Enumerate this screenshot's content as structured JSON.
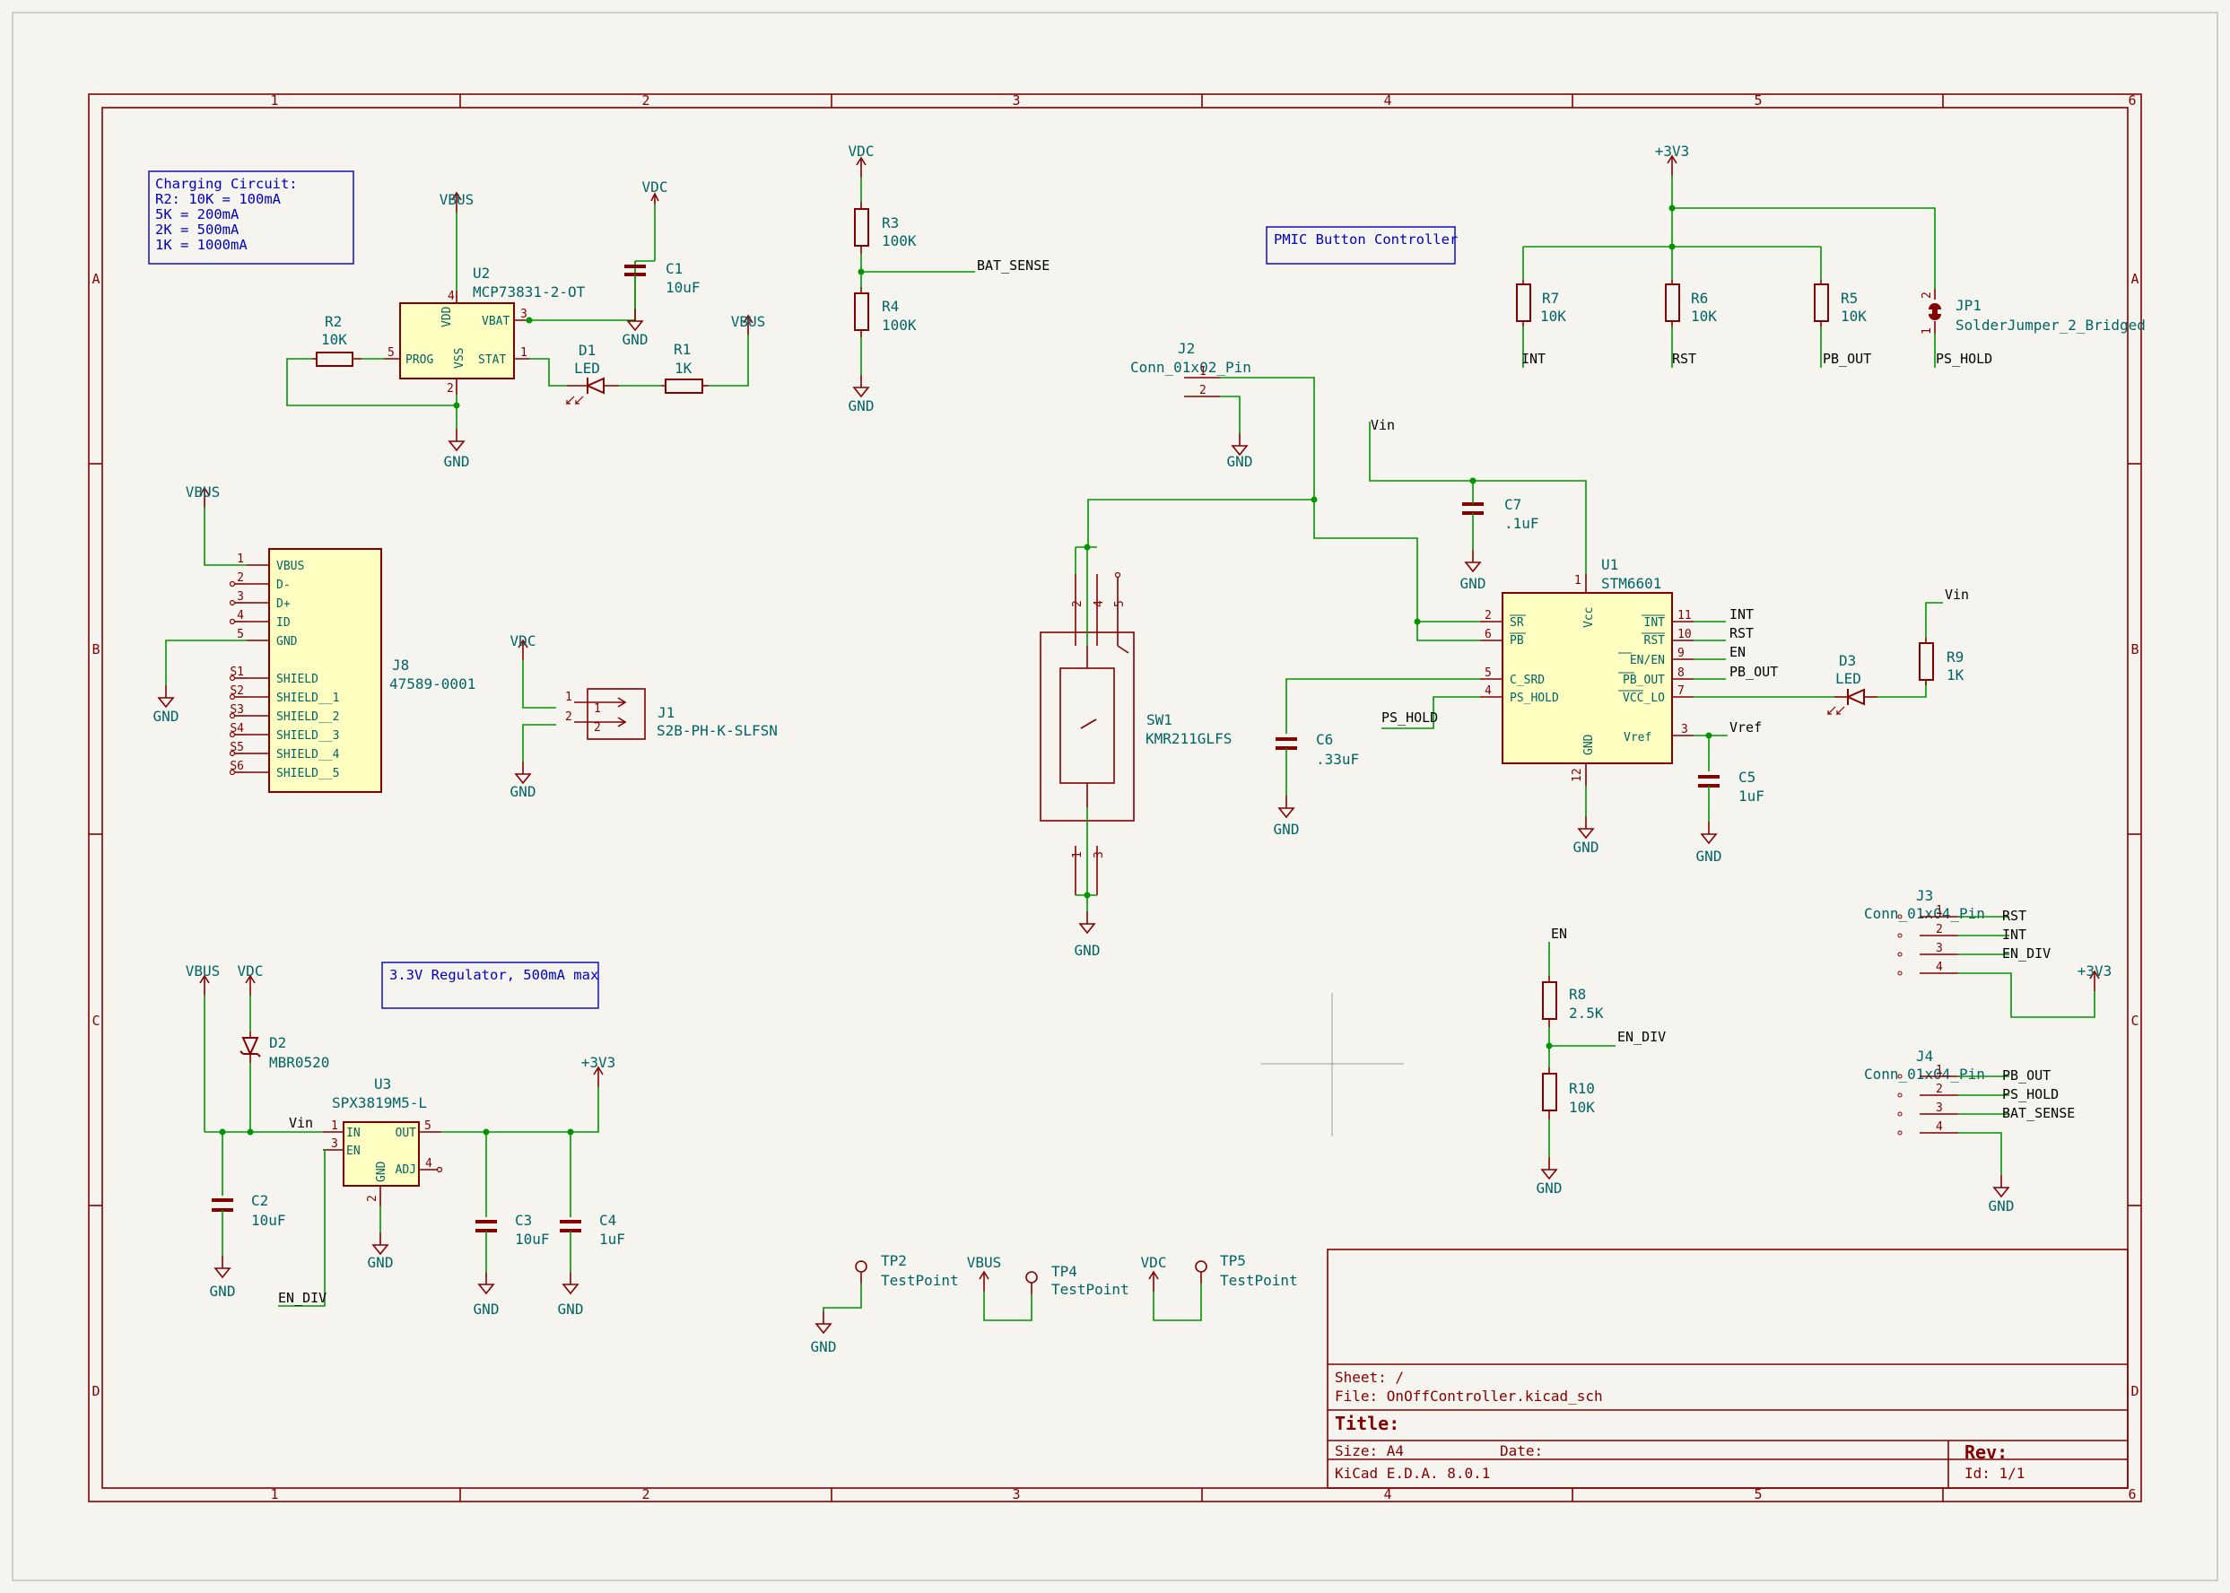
{
  "sheet": {
    "zone_cols": [
      "1",
      "2",
      "3",
      "4",
      "5",
      "6"
    ],
    "zone_rows": [
      "A",
      "B",
      "C",
      "D"
    ]
  },
  "notes": {
    "charging_lines": [
      "Charging Circuit:",
      "R2: 10K = 100mA",
      "5K = 200mA",
      "2K = 500mA",
      "1K = 1000mA"
    ],
    "pmic": "PMIC Button Controller",
    "regulator": "3.3V Regulator, 500mA max"
  },
  "symbols": {
    "u2": {
      "ref": "U2",
      "value": "MCP73831-2-OT",
      "pins": {
        "vdd": "VDD",
        "vbat": "VBAT",
        "prog": "PROG",
        "vss": "VSS",
        "stat": "STAT"
      },
      "pin_nums": [
        "4",
        "3",
        "5",
        "2",
        "1"
      ]
    },
    "r2": {
      "ref": "R2",
      "value": "10K"
    },
    "c1": {
      "ref": "C1",
      "value": "10uF"
    },
    "d1": {
      "ref": "D1",
      "value": "LED"
    },
    "r1": {
      "ref": "R1",
      "value": "1K"
    },
    "r3": {
      "ref": "R3",
      "value": "100K"
    },
    "r4": {
      "ref": "R4",
      "value": "100K"
    },
    "j8": {
      "ref": "J8",
      "value": "47589-0001",
      "pins": [
        "VBUS",
        "D-",
        "D+",
        "ID",
        "GND",
        "SHIELD",
        "SHIELD__1",
        "SHIELD__2",
        "SHIELD__3",
        "SHIELD__4",
        "SHIELD__5"
      ],
      "pin_nums": [
        "1",
        "2",
        "3",
        "4",
        "5",
        "S1",
        "S2",
        "S3",
        "S4",
        "S5",
        "S6"
      ]
    },
    "j1": {
      "ref": "J1",
      "value": "S2B-PH-K-SLFSN",
      "pin_nums": [
        "1",
        "2"
      ]
    },
    "j2": {
      "ref": "J2",
      "value": "Conn_01x02_Pin",
      "pin_nums": [
        "1",
        "2"
      ]
    },
    "sw1": {
      "ref": "SW1",
      "value": "KMR211GLFS",
      "pin_nums": [
        "2",
        "4",
        "5",
        "1",
        "3"
      ]
    },
    "c7": {
      "ref": "C7",
      "value": ".1uF"
    },
    "c6": {
      "ref": "C6",
      "value": ".33uF"
    },
    "u1": {
      "ref": "U1",
      "value": "STM6601",
      "pins": {
        "vcc": "Vcc",
        "sr": "SR",
        "pb": "PB",
        "csrd": "C_SRD",
        "pshold": "PS_HOLD",
        "int": "INT",
        "rst": "RST",
        "enen": "EN/EN",
        "pbout": "PB_OUT",
        "vccl": "VCC_LO",
        "vref": "Vref",
        "gnd": "GND"
      },
      "pin_nums": [
        "1",
        "2",
        "6",
        "5",
        "4",
        "11",
        "10",
        "9",
        "8",
        "7",
        "3",
        "12"
      ]
    },
    "c5": {
      "ref": "C5",
      "value": "1uF"
    },
    "d3": {
      "ref": "D3",
      "value": "LED"
    },
    "r9": {
      "ref": "R9",
      "value": "1K"
    },
    "r7": {
      "ref": "R7",
      "value": "10K"
    },
    "r6": {
      "ref": "R6",
      "value": "10K"
    },
    "r5": {
      "ref": "R5",
      "value": "10K"
    },
    "jp1": {
      "ref": "JP1",
      "value": "SolderJumper_2_Bridged",
      "pin_nums": [
        "2",
        "1"
      ]
    },
    "d2": {
      "ref": "D2",
      "value": "MBR0520"
    },
    "u3": {
      "ref": "U3",
      "value": "SPX3819M5-L",
      "pins": {
        "in": "IN",
        "en": "EN",
        "out": "OUT",
        "adj": "ADJ",
        "gnd": "GND"
      },
      "pin_nums": [
        "1",
        "3",
        "5",
        "4",
        "2"
      ]
    },
    "c2": {
      "ref": "C2",
      "value": "10uF"
    },
    "c3": {
      "ref": "C3",
      "value": "10uF"
    },
    "c4": {
      "ref": "C4",
      "value": "1uF"
    },
    "r8": {
      "ref": "R8",
      "value": "2.5K"
    },
    "r10": {
      "ref": "R10",
      "value": "10K"
    },
    "j3": {
      "ref": "J3",
      "value": "Conn_01x04_Pin",
      "pin_nums": [
        "1",
        "2",
        "3",
        "4"
      ]
    },
    "j4": {
      "ref": "J4",
      "value": "Conn_01x04_Pin",
      "pin_nums": [
        "1",
        "2",
        "3",
        "4"
      ]
    },
    "tp2": {
      "ref": "TP2",
      "value": "TestPoint"
    },
    "tp4": {
      "ref": "TP4",
      "value": "TestPoint"
    },
    "tp5": {
      "ref": "TP5",
      "value": "TestPoint"
    }
  },
  "power": {
    "vbus": "VBUS",
    "vdc": "VDC",
    "gnd": "GND",
    "v3v3": "+3V3",
    "vin": "Vin"
  },
  "nets": {
    "bat_sense": "BAT_SENSE",
    "int": "INT",
    "rst": "RST",
    "en": "EN",
    "pb_out": "PB_OUT",
    "ps_hold": "PS_HOLD",
    "vref": "Vref",
    "en_div": "EN_DIV",
    "vin": "Vin"
  },
  "title_block": {
    "sheet": "Sheet: /",
    "file": "File: OnOffController.kicad_sch",
    "title": "Title:",
    "size": "Size: A4",
    "date": "Date:",
    "rev": "Rev:",
    "tool": "KiCad E.D.A. 8.0.1",
    "id": "Id: 1/1"
  }
}
